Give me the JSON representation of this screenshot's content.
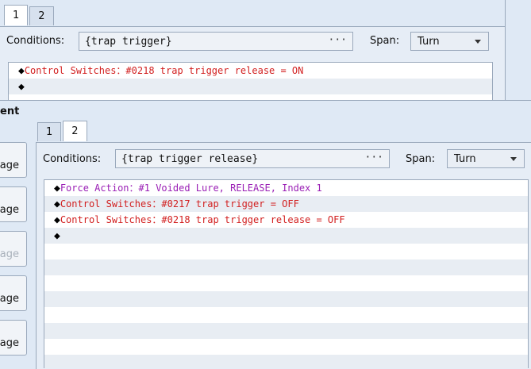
{
  "back_panel": {
    "tabs": [
      "1",
      "2"
    ],
    "conditions_label": "Conditions:",
    "conditions_value": "{trap trigger}",
    "ellipsis": "···",
    "span_label": "Span:",
    "span_value": "Turn",
    "rows": [
      {
        "diamond": "◆",
        "text": "Control Switches：#0218 trap trigger release = ON",
        "color": "red"
      },
      {
        "diamond": "◆",
        "text": "",
        "color": "red"
      }
    ]
  },
  "section_header": "ent",
  "side_buttons": [
    {
      "label": "age",
      "enabled": true
    },
    {
      "label": "age",
      "enabled": true
    },
    {
      "label": "age",
      "enabled": false
    },
    {
      "label": "age",
      "enabled": true
    },
    {
      "label": "age",
      "enabled": true
    }
  ],
  "front_panel": {
    "tabs": [
      "1",
      "2"
    ],
    "active_tab": "2",
    "conditions_label": "Conditions:",
    "conditions_value": "{trap trigger release}",
    "ellipsis": "···",
    "span_label": "Span:",
    "span_value": "Turn",
    "rows": [
      {
        "diamond": "◆",
        "text": "Force Action：#1 Voided Lure, RELEASE, Index 1",
        "color": "purple"
      },
      {
        "diamond": "◆",
        "text": "Control Switches：#0217 trap trigger = OFF",
        "color": "red"
      },
      {
        "diamond": "◆",
        "text": "Control Switches：#0218 trap trigger release = OFF",
        "color": "red"
      },
      {
        "diamond": "◆",
        "text": "",
        "color": "red"
      }
    ]
  },
  "colors": {
    "red": "#d21f1f",
    "purple": "#9a1fb5",
    "background": "#dfe9f5"
  }
}
